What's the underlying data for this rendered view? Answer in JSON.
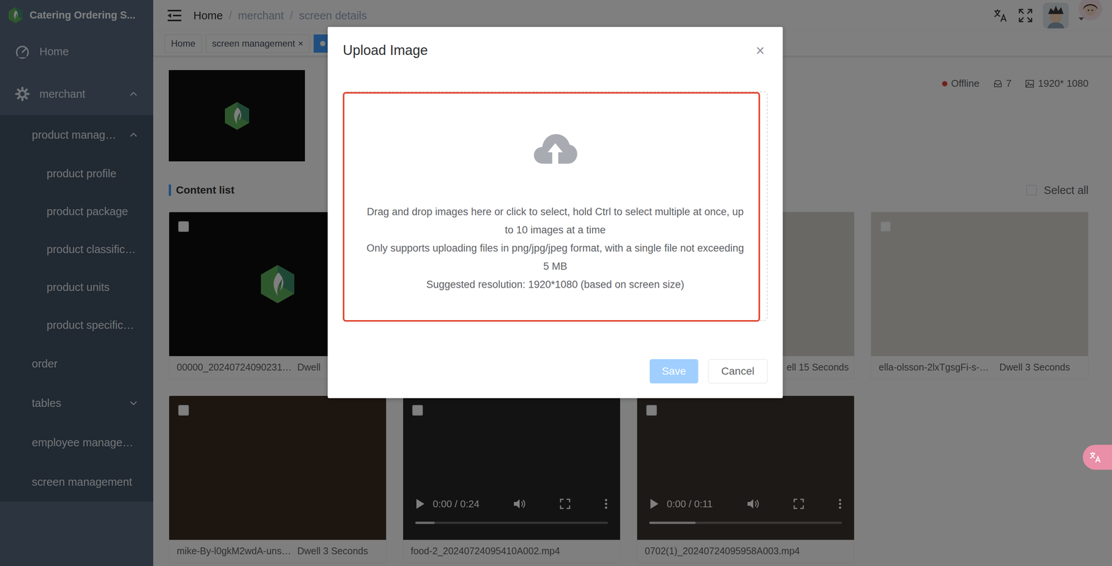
{
  "app": {
    "title": "Catering Ordering S..."
  },
  "sidebar": {
    "items": [
      {
        "label": "Home",
        "kind": "top"
      },
      {
        "label": "merchant",
        "kind": "top",
        "expanded": true
      },
      {
        "label": "product manag…",
        "kind": "group",
        "expanded": true
      },
      {
        "label": "product profile",
        "kind": "leaf"
      },
      {
        "label": "product package",
        "kind": "leaf"
      },
      {
        "label": "product classific…",
        "kind": "leaf"
      },
      {
        "label": "product units",
        "kind": "leaf"
      },
      {
        "label": "product specific…",
        "kind": "leaf"
      },
      {
        "label": "order",
        "kind": "group"
      },
      {
        "label": "tables",
        "kind": "group",
        "expanded": false
      },
      {
        "label": "employee manage…",
        "kind": "group"
      },
      {
        "label": "screen management",
        "kind": "group"
      }
    ]
  },
  "breadcrumb": {
    "separator": "/",
    "items": [
      {
        "label": "Home",
        "linked": true
      },
      {
        "label": "merchant",
        "linked": false
      },
      {
        "label": "screen details",
        "linked": false
      }
    ]
  },
  "tags": [
    {
      "label": "Home",
      "selected": false
    },
    {
      "label": "screen management",
      "close": "×",
      "selected": false
    },
    {
      "selected": true
    }
  ],
  "screen": {
    "status": {
      "label": "Offline",
      "color": "#e0453a"
    },
    "count": "7",
    "resolution": "1920* 1080"
  },
  "content": {
    "title": "Content list",
    "select_all": {
      "label": "Select all",
      "checked": false
    },
    "cards": [
      {
        "kind": "logo",
        "name": "00000_20240724090231…",
        "dwell": "Dwell",
        "checked": false
      },
      {
        "kind": "photo"
      },
      {
        "kind": "photo",
        "dwell": "ell 15 Seconds"
      },
      {
        "kind": "photo",
        "name": "ella-olsson-2lxTgsgFi-s-…",
        "dwell": "Dwell 3 Seconds",
        "checked": false
      },
      {
        "kind": "photo",
        "name": "mike-By-l0gkM2wdA-uns…",
        "dwell": "Dwell 3 Seconds",
        "checked": false
      },
      {
        "kind": "video",
        "name": "food-2_20240724095410A002.mp4",
        "time": "0:00 / 0:24",
        "level": 0.1,
        "checked": false
      },
      {
        "kind": "video",
        "name": "0702(1)_20240724095958A003.mp4",
        "time": "0:00 / 0:11",
        "level": 0.24,
        "checked": false
      }
    ]
  },
  "dialog": {
    "title": "Upload Image",
    "close": "×",
    "hints": [
      "Drag and drop images here or click to select, hold Ctrl to select multiple at once, up to 10 images at a time",
      "Only supports uploading files in png/jpg/jpeg format, with a single file not exceeding 5 MB",
      "Suggested resolution: 1920*1080 (based on screen size)"
    ],
    "buttons": [
      {
        "label": "Save",
        "disabled": true
      },
      {
        "label": "Cancel",
        "disabled": false
      }
    ]
  }
}
